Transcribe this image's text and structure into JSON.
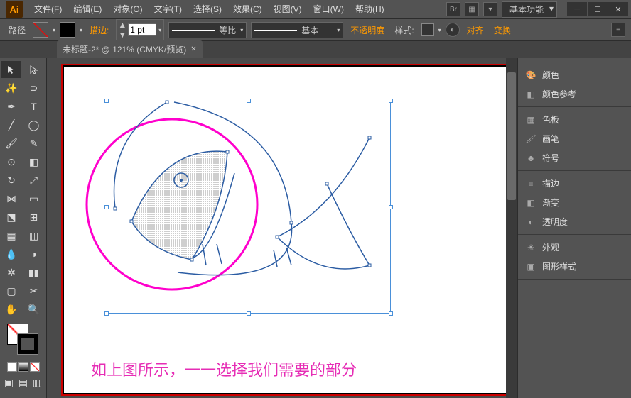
{
  "titlebar": {
    "logo": "Ai"
  },
  "menu": {
    "file": "文件(F)",
    "edit": "编辑(E)",
    "object": "对象(O)",
    "type": "文字(T)",
    "select": "选择(S)",
    "effect": "效果(C)",
    "view": "视图(V)",
    "window": "窗口(W)",
    "help": "帮助(H)"
  },
  "workspace": {
    "name": "基本功能"
  },
  "controlbar": {
    "label": "路径",
    "stroke_label": "描边:",
    "stroke_value": "1 pt",
    "uniform": "等比",
    "basic": "基本",
    "opacity": "不透明度",
    "style": "样式:",
    "align": "对齐",
    "transform": "变换"
  },
  "document": {
    "tab_label": "未标题-2* @ 121% (CMYK/预览)"
  },
  "canvas": {
    "caption": "如上图所示，一一选择我们需要的部分"
  },
  "panels": {
    "color": "颜色",
    "color_guide": "颜色参考",
    "swatches": "色板",
    "brushes": "画笔",
    "symbols": "符号",
    "stroke": "描边",
    "gradient": "渐变",
    "transparency": "透明度",
    "appearance": "外观",
    "graphic_styles": "图形样式"
  }
}
